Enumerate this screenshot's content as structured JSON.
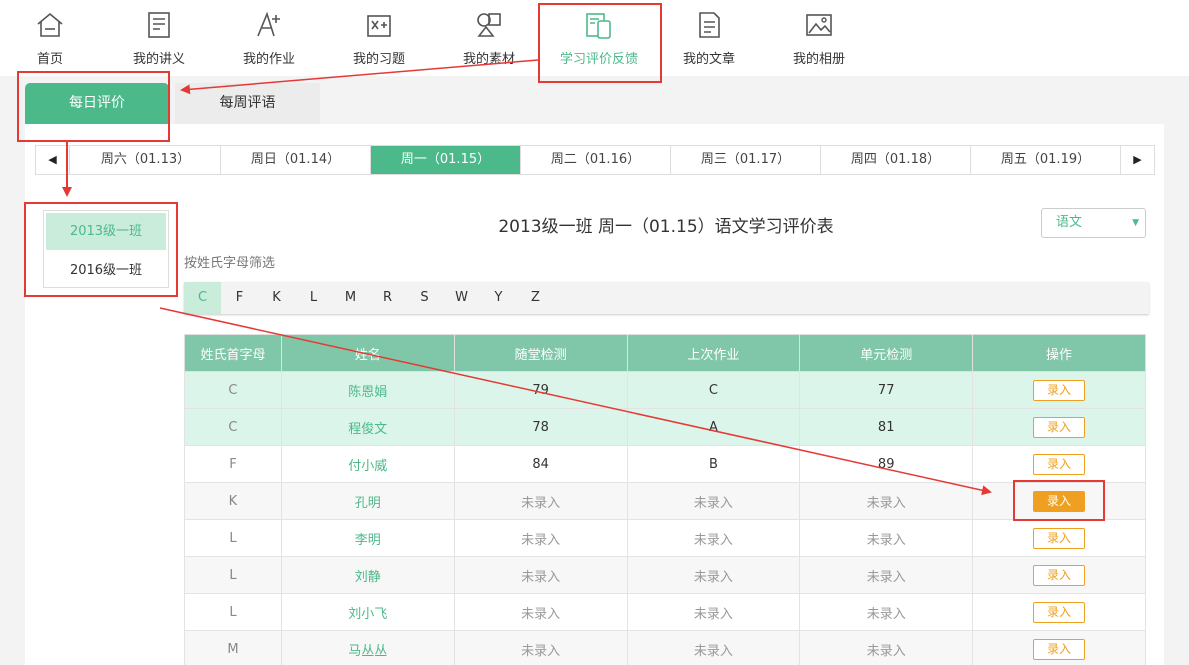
{
  "nav": [
    {
      "label": "首页",
      "icon": "home-icon"
    },
    {
      "label": "我的讲义",
      "icon": "handout-icon"
    },
    {
      "label": "我的作业",
      "icon": "homework-icon"
    },
    {
      "label": "我的习题",
      "icon": "exercise-icon"
    },
    {
      "label": "我的素材",
      "icon": "material-icon"
    },
    {
      "label": "学习评价反馈",
      "icon": "feedback-icon",
      "active": true
    },
    {
      "label": "我的文章",
      "icon": "article-icon"
    },
    {
      "label": "我的相册",
      "icon": "album-icon"
    }
  ],
  "subtabs": {
    "daily": "每日评价",
    "weekly": "每周评语"
  },
  "days": [
    "周六（01.13）",
    "周日（01.14）",
    "周一（01.15）",
    "周二（01.16）",
    "周三（01.17）",
    "周四（01.18）",
    "周五（01.19）"
  ],
  "active_day": 2,
  "classes": [
    "2013级一班",
    "2016级一班"
  ],
  "sheet_title": "2013级一班 周一（01.15）语文学习评价表",
  "subject": "语文",
  "filter_label": "按姓氏字母筛选",
  "letters": [
    "C",
    "F",
    "K",
    "L",
    "M",
    "R",
    "S",
    "W",
    "Y",
    "Z"
  ],
  "table": {
    "headers": [
      "姓氏首字母",
      "姓名",
      "随堂检测",
      "上次作业",
      "单元检测",
      "操作"
    ],
    "rows": [
      {
        "letter": "C",
        "name": "陈恩娟",
        "quiz": "79",
        "homework": "C",
        "unit": "77",
        "action": "录入"
      },
      {
        "letter": "C",
        "name": "程俊文",
        "quiz": "78",
        "homework": "A",
        "unit": "81",
        "action": "录入"
      },
      {
        "letter": "F",
        "name": "付小威",
        "quiz": "84",
        "homework": "B",
        "unit": "89",
        "action": "录入"
      },
      {
        "letter": "K",
        "name": "孔明",
        "quiz": "未录入",
        "homework": "未录入",
        "unit": "未录入",
        "action": "录入"
      },
      {
        "letter": "L",
        "name": "李明",
        "quiz": "未录入",
        "homework": "未录入",
        "unit": "未录入",
        "action": "录入"
      },
      {
        "letter": "L",
        "name": "刘静",
        "quiz": "未录入",
        "homework": "未录入",
        "unit": "未录入",
        "action": "录入"
      },
      {
        "letter": "L",
        "name": "刘小飞",
        "quiz": "未录入",
        "homework": "未录入",
        "unit": "未录入",
        "action": "录入"
      },
      {
        "letter": "M",
        "name": "马丛丛",
        "quiz": "未录入",
        "homework": "未录入",
        "unit": "未录入",
        "action": "录入"
      }
    ]
  },
  "colors": {
    "accent": "#4cb98a",
    "annotation": "#e53935",
    "button": "#f0a020"
  }
}
